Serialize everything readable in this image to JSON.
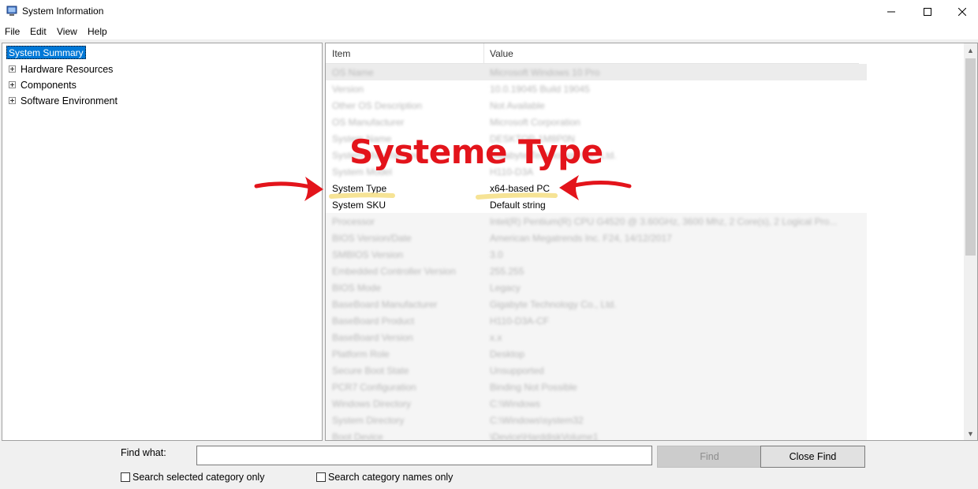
{
  "window": {
    "title": "System Information"
  },
  "menu": [
    "File",
    "Edit",
    "View",
    "Help"
  ],
  "tree": {
    "root": "System Summary",
    "children": [
      "Hardware Resources",
      "Components",
      "Software Environment"
    ]
  },
  "table": {
    "columns": [
      "Item",
      "Value"
    ],
    "rows": [
      {
        "item": "OS Name",
        "value": "Microsoft Windows 10 Pro"
      },
      {
        "item": "Version",
        "value": "10.0.19045 Build 19045"
      },
      {
        "item": "Other OS Description",
        "value": "Not Available"
      },
      {
        "item": "OS Manufacturer",
        "value": "Microsoft Corporation"
      },
      {
        "item": "System Name",
        "value": "DESKTOP-1M8P0N"
      },
      {
        "item": "System Manufacturer",
        "value": "Gigabyte Technology Co., Ltd."
      },
      {
        "item": "System Model",
        "value": "H110-D3A"
      },
      {
        "item": "System Type",
        "value": "x64-based PC"
      },
      {
        "item": "System SKU",
        "value": "Default string"
      },
      {
        "item": "Processor",
        "value": "Intel(R) Pentium(R) CPU G4520 @ 3.60GHz, 3600 Mhz, 2 Core(s), 2 Logical Pro..."
      },
      {
        "item": "BIOS Version/Date",
        "value": "American Megatrends Inc. F24, 14/12/2017"
      },
      {
        "item": "SMBIOS Version",
        "value": "3.0"
      },
      {
        "item": "Embedded Controller Version",
        "value": "255.255"
      },
      {
        "item": "BIOS Mode",
        "value": "Legacy"
      },
      {
        "item": "BaseBoard Manufacturer",
        "value": "Gigabyte Technology Co., Ltd."
      },
      {
        "item": "BaseBoard Product",
        "value": "H110-D3A-CF"
      },
      {
        "item": "BaseBoard Version",
        "value": "x.x"
      },
      {
        "item": "Platform Role",
        "value": "Desktop"
      },
      {
        "item": "Secure Boot State",
        "value": "Unsupported"
      },
      {
        "item": "PCR7 Configuration",
        "value": "Binding Not Possible"
      },
      {
        "item": "Windows Directory",
        "value": "C:\\Windows"
      },
      {
        "item": "System Directory",
        "value": "C:\\Windows\\system32"
      },
      {
        "item": "Boot Device",
        "value": "\\Device\\HarddiskVolume1"
      }
    ]
  },
  "annotation": {
    "title": "Systeme Type",
    "color": "#e3141b",
    "highlight_color": "#f5e08a"
  },
  "find_bar": {
    "label": "Find what:",
    "input_value": "",
    "find_button": "Find",
    "close_button": "Close Find",
    "check_selected": "Search selected category only",
    "check_names": "Search category names only"
  }
}
